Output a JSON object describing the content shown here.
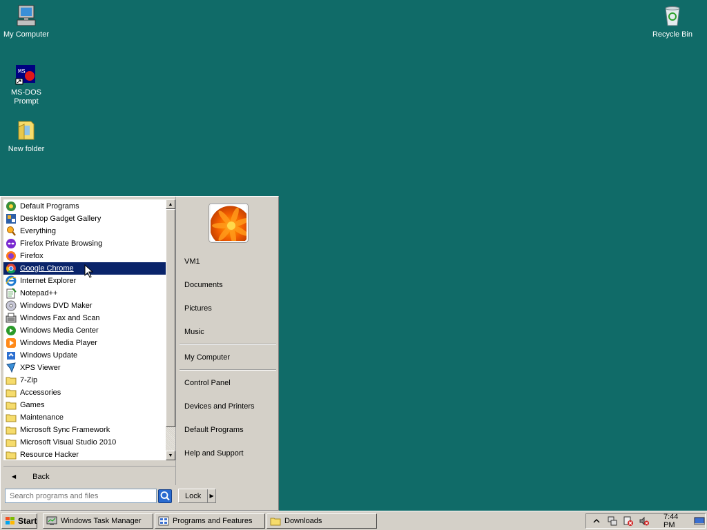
{
  "desktop": {
    "icons": [
      {
        "label": "My Computer",
        "icon": "my-computer-icon"
      },
      {
        "label": "MS-DOS Prompt",
        "icon": "ms-dos-icon"
      },
      {
        "label": "New folder",
        "icon": "folder-icon"
      },
      {
        "label": "Recycle Bin",
        "icon": "recycle-bin-icon"
      }
    ]
  },
  "start_menu": {
    "programs": [
      {
        "label": "Default Programs",
        "icon": "default-programs-icon"
      },
      {
        "label": "Desktop Gadget Gallery",
        "icon": "gadget-icon"
      },
      {
        "label": "Everything",
        "icon": "search-magnifier-icon"
      },
      {
        "label": "Firefox Private Browsing",
        "icon": "firefox-private-icon"
      },
      {
        "label": "Firefox",
        "icon": "firefox-icon"
      },
      {
        "label": "Google Chrome",
        "icon": "chrome-icon",
        "selected": true
      },
      {
        "label": "Internet Explorer",
        "icon": "ie-icon"
      },
      {
        "label": "Notepad++",
        "icon": "notepad-icon"
      },
      {
        "label": "Windows DVD Maker",
        "icon": "dvd-icon"
      },
      {
        "label": "Windows Fax and Scan",
        "icon": "fax-icon"
      },
      {
        "label": "Windows Media Center",
        "icon": "media-center-icon"
      },
      {
        "label": "Windows Media Player",
        "icon": "media-player-icon"
      },
      {
        "label": "Windows Update",
        "icon": "windows-update-icon"
      },
      {
        "label": "XPS Viewer",
        "icon": "xps-icon"
      },
      {
        "label": "7-Zip",
        "icon": "folder-icon"
      },
      {
        "label": "Accessories",
        "icon": "folder-icon"
      },
      {
        "label": "Games",
        "icon": "folder-icon"
      },
      {
        "label": "Maintenance",
        "icon": "folder-icon"
      },
      {
        "label": "Microsoft Sync Framework",
        "icon": "folder-icon"
      },
      {
        "label": "Microsoft Visual Studio 2010",
        "icon": "folder-icon"
      },
      {
        "label": "Resource Hacker",
        "icon": "folder-icon"
      }
    ],
    "back_label": "Back",
    "search_placeholder": "Search programs and files",
    "right_items": {
      "user": "VM1",
      "documents": "Documents",
      "pictures": "Pictures",
      "music": "Music",
      "my_computer": "My Computer",
      "control_panel": "Control Panel",
      "devices": "Devices and Printers",
      "default_programs": "Default Programs",
      "help": "Help and Support"
    },
    "lock_label": "Lock"
  },
  "taskbar": {
    "start_label": "Start",
    "tasks": [
      {
        "label": "Windows Task Manager",
        "icon": "task-manager-icon"
      },
      {
        "label": "Programs and Features",
        "icon": "programs-features-icon"
      },
      {
        "label": "Downloads",
        "icon": "folder-icon"
      }
    ],
    "clock": "7:44 PM"
  },
  "colors": {
    "desktop": "#106b68",
    "selection": "#0a246a",
    "chrome_face": "#d4d0c8"
  }
}
